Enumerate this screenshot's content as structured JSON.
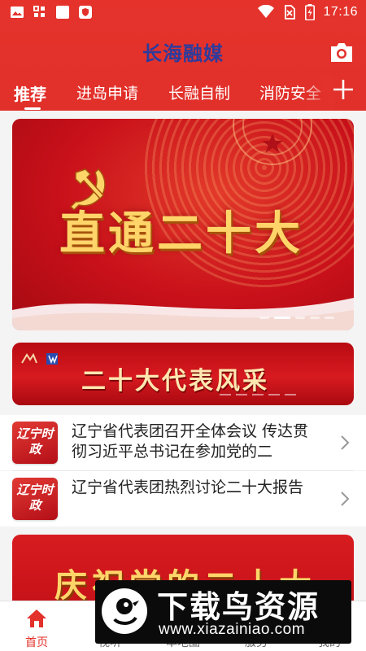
{
  "status_bar": {
    "time": "17:16",
    "left_icons": [
      "image-icon",
      "grid-icon",
      "square-icon",
      "shield-icon"
    ],
    "right_icons": [
      "wifi-icon",
      "no-sim-icon",
      "battery-charging-icon"
    ]
  },
  "header": {
    "app_title": "长海融媒",
    "camera_icon": "camera-icon"
  },
  "tabs": {
    "items": [
      {
        "label": "推荐",
        "active": true
      },
      {
        "label": "进岛申请",
        "active": false
      },
      {
        "label": "长融自制",
        "active": false
      },
      {
        "label": "消防安全",
        "active": false
      }
    ],
    "add_icon": "plus-icon"
  },
  "banner": {
    "title": "直通二十大",
    "slides_total": 5,
    "active_slide": 2
  },
  "strip_banner": {
    "title": "二十大代表风采"
  },
  "news": [
    {
      "thumb_text": "辽宁时政",
      "title": "辽宁省代表团召开全体会议 传达贯彻习近平总书记在参加党的二"
    },
    {
      "thumb_text": "辽宁时政",
      "title": "辽宁省代表团热烈讨论二十大报告"
    }
  ],
  "banner3": {
    "title": "庆祝党的二十大"
  },
  "bottom_nav": {
    "items": [
      {
        "label": "首页",
        "icon": "home-icon",
        "active": true
      },
      {
        "label": "视听",
        "icon": "video-icon",
        "active": false
      },
      {
        "label": "本地圈",
        "icon": "circle-icon",
        "active": false
      },
      {
        "label": "服务",
        "icon": "service-icon",
        "active": false
      },
      {
        "label": "我的",
        "icon": "user-icon",
        "active": false
      }
    ]
  },
  "watermark": {
    "title": "下载鸟资源",
    "url": "www.xiazainiao.com"
  },
  "colors": {
    "brand_red": "#e3312b",
    "logo_blue": "#2d3b9c",
    "gold": "#ffd56a"
  }
}
